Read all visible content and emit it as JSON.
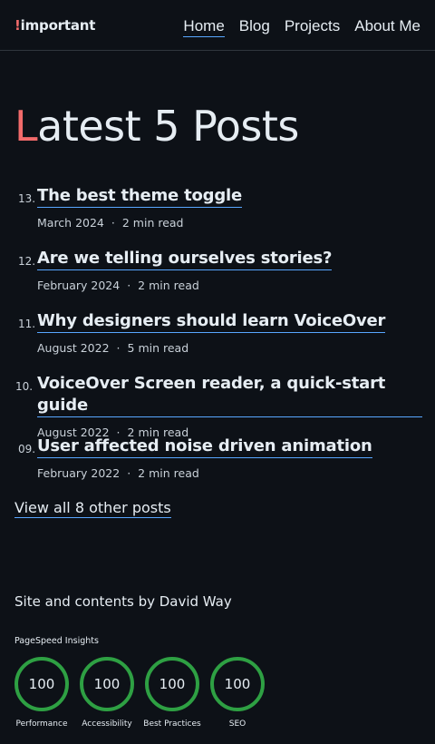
{
  "header": {
    "logo_bang": "!",
    "logo_text": "important",
    "nav": [
      {
        "label": "Home",
        "active": true
      },
      {
        "label": "Blog",
        "active": false
      },
      {
        "label": "Projects",
        "active": false
      },
      {
        "label": "About Me",
        "active": false
      }
    ]
  },
  "title": {
    "first_letter": "L",
    "rest": "atest 5 Posts"
  },
  "posts": [
    {
      "number": "13.",
      "title": "The best theme toggle",
      "date": "March 2024",
      "read": "2 min read"
    },
    {
      "number": "12.",
      "title": "Are we telling ourselves stories?",
      "date": "February 2024",
      "read": "2 min read"
    },
    {
      "number": "11.",
      "title": "Why designers should learn VoiceOver",
      "date": "August 2022",
      "read": "5 min read"
    },
    {
      "number": "10.",
      "title": "VoiceOver Screen reader, a quick-start guide",
      "date": "August 2022",
      "read": "2 min read"
    },
    {
      "number": "09.",
      "title": "User affected noise driven animation",
      "date": "February 2022",
      "read": "2 min read"
    }
  ],
  "separator": "·",
  "view_all": "View all 8 other posts",
  "footer": {
    "credit": "Site and contents by David Way",
    "pagespeed_label": "PageSpeed Insights",
    "scores": [
      {
        "value": "100",
        "label": "Performance"
      },
      {
        "value": "100",
        "label": "Accessibility"
      },
      {
        "value": "100",
        "label": "Best Practices"
      },
      {
        "value": "100",
        "label": "SEO"
      }
    ]
  },
  "colors": {
    "background": "#0d1117",
    "accent": "#f26b6b",
    "link_underline": "#58a6ff",
    "score_ring": "#2ea043"
  }
}
